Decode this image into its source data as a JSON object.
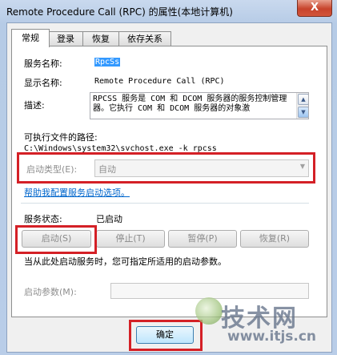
{
  "window": {
    "title": "Remote Procedure Call (RPC) 的属性(本地计算机)",
    "close_glyph": "X"
  },
  "tabs": [
    "常规",
    "登录",
    "恢复",
    "依存关系"
  ],
  "general": {
    "service_name_label": "服务名称:",
    "service_name_value": "RpcSs",
    "display_name_label": "显示名称:",
    "display_name_value": "Remote Procedure Call (RPC)",
    "description_label": "描述:",
    "description_value": "RPCSS 服务是 COM 和 DCOM 服务器的服务控制管理器。它执行 COM 和 DCOM 服务器的对象激",
    "exec_path_label": "可执行文件的路径:",
    "exec_path_value": "C:\\Windows\\system32\\svchost.exe -k rpcss",
    "startup_type_label": "启动类型(E):",
    "startup_type_value": "自动",
    "help_link": "帮助我配置服务启动选项。",
    "service_status_label": "服务状态:",
    "service_status_value": "已启动",
    "buttons": {
      "start": "启动(S)",
      "stop": "停止(T)",
      "pause": "暂停(P)",
      "resume": "恢复(R)"
    },
    "start_params_hint": "当从此处启动服务时，您可指定所适用的启动参数。",
    "start_params_label": "启动参数(M):",
    "start_params_value": ""
  },
  "footer": {
    "ok": "确定"
  },
  "watermark": {
    "brand": "技术网",
    "url": "www.itjs.cn"
  },
  "colors": {
    "highlight_red": "#d42026",
    "link_blue": "#0066cc",
    "selection_blue": "#3399ff"
  }
}
